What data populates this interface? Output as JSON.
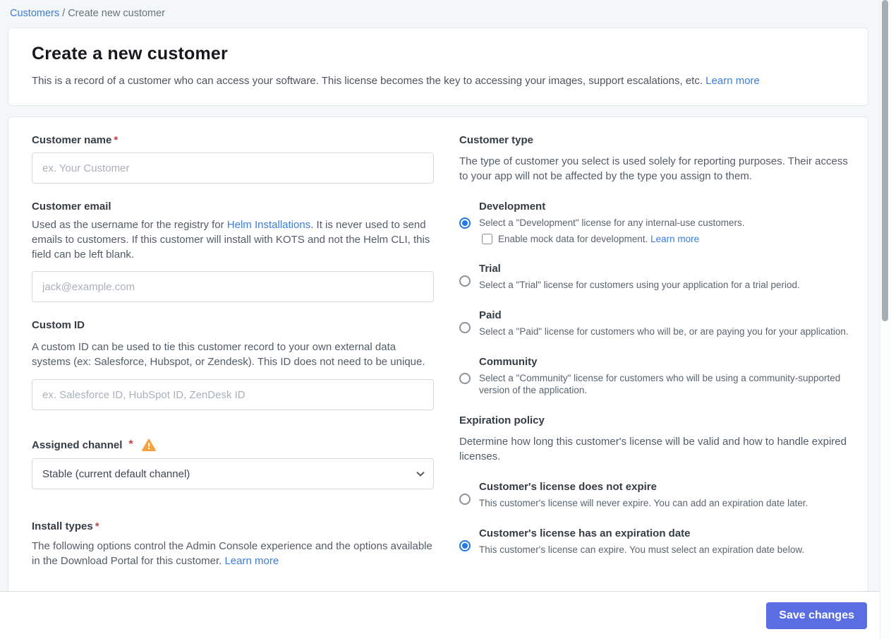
{
  "colors": {
    "link_blue": "#3b7dd8",
    "button_indigo": "#5b6ee1",
    "radio_selected_blue": "#2377e8",
    "required_red": "#c0444a",
    "warning_amber": "#f5a33c"
  },
  "breadcrumb": {
    "link": "Customers",
    "separator": " / ",
    "current": "Create new customer"
  },
  "header": {
    "title": "Create a new customer",
    "description": "This is a record of a customer who can access your software. This license becomes the key to accessing your images, support escalations, etc. ",
    "learn_more": "Learn more"
  },
  "form": {
    "customer_name": {
      "label": "Customer name",
      "required": "*",
      "placeholder": "ex. Your Customer",
      "value": ""
    },
    "customer_email": {
      "label": "Customer email",
      "desc_before": "Used as the username for the registry for ",
      "desc_link": "Helm Installations",
      "desc_after": ". It is never used to send emails to customers. If this customer will install with KOTS and not the Helm CLI, this field can be left blank.",
      "placeholder": "jack@example.com",
      "value": ""
    },
    "custom_id": {
      "label": "Custom ID",
      "description": "A custom ID can be used to tie this customer record to your own external data systems (ex: Salesforce, Hubspot, or Zendesk). This ID does not need to be unique.",
      "placeholder": "ex. Salesforce ID, HubSpot ID, ZenDesk ID",
      "value": ""
    },
    "assigned_channel": {
      "label": "Assigned channel",
      "required": "*",
      "warning_icon": "warning-triangle-icon",
      "selected_option": "Stable (current default channel)"
    },
    "install_types": {
      "label": "Install types",
      "required": "*",
      "description": "The following options control the Admin Console experience and the options available in the Download Portal for this customer. ",
      "learn_more": "Learn more"
    }
  },
  "customer_type": {
    "label": "Customer type",
    "description": "The type of customer you select is used solely for reporting purposes. Their access to your app will not be affected by the type you assign to them.",
    "options": [
      {
        "title": "Development",
        "description": "Select a \"Development\" license for any internal-use customers.",
        "selected": true,
        "checkbox_label": "Enable mock data for development. ",
        "checkbox_learn_more": "Learn more",
        "checkbox_checked": false
      },
      {
        "title": "Trial",
        "description": "Select a \"Trial\" license for customers using your application for a trial period.",
        "selected": false
      },
      {
        "title": "Paid",
        "description": "Select a \"Paid\" license for customers who will be, or are paying you for your application.",
        "selected": false
      },
      {
        "title": "Community",
        "description": "Select a \"Community\" license for customers who will be using a community-supported version of the application.",
        "selected": false
      }
    ]
  },
  "expiration_policy": {
    "label": "Expiration policy",
    "description": "Determine how long this customer's license will be valid and how to handle expired licenses.",
    "options": [
      {
        "title": "Customer's license does not expire",
        "description": "This customer's license will never expire. You can add an expiration date later.",
        "selected": false
      },
      {
        "title": "Customer's license has an expiration date",
        "description": "This customer's license can expire. You must select an expiration date below.",
        "selected": true
      }
    ]
  },
  "footer": {
    "save_button": "Save changes"
  }
}
